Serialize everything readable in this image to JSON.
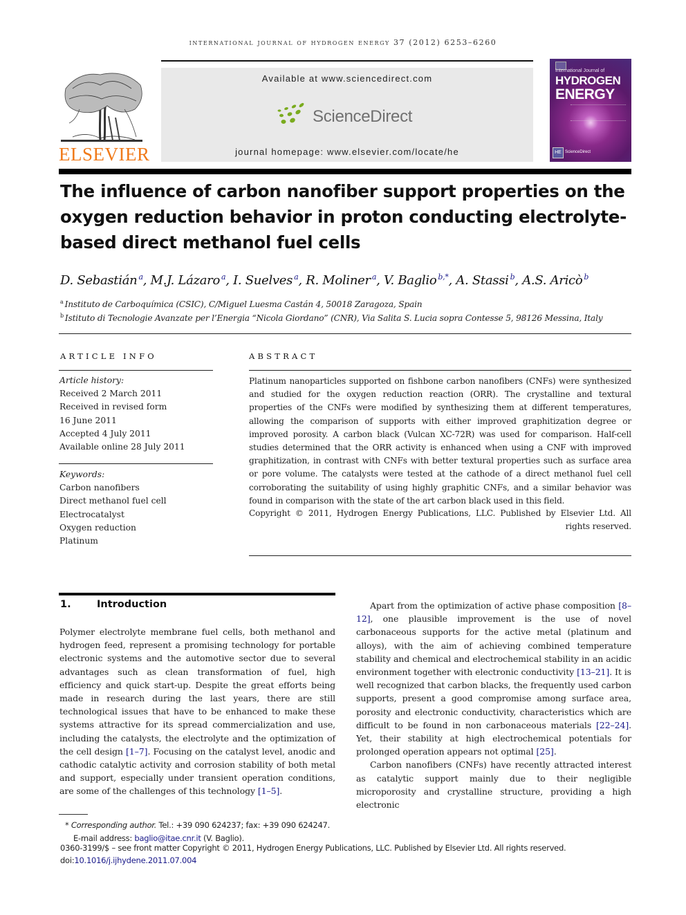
{
  "header": {
    "running_head": "International Journal of Hydrogen Energy 37 (2012) 6253–6260",
    "publisher_logo_text": "ELSEVIER",
    "available_at": "Available at www.sciencedirect.com",
    "sciencedirect_brand": "ScienceDirect",
    "journal_homepage": "journal homepage: www.elsevier.com/locate/he",
    "cover": {
      "small_title": "International Journal of",
      "title_line1": "HYDROGEN",
      "title_line2": "ENERGY",
      "badge": "HE",
      "footer": "ScienceDirect"
    },
    "colors": {
      "elsevier_orange": "#f07a1a",
      "sciencedirect_green": "#7aab1e",
      "sciencedirect_gray": "#707070",
      "link_blue": "#1a1a8a",
      "banner_gray": "#e9e9e9"
    }
  },
  "article": {
    "title": "The influence of carbon nanofiber support properties on the oxygen reduction behavior in proton conducting electrolyte-based direct methanol fuel cells",
    "authors": [
      {
        "name": "D. Sebastián",
        "sup": "a"
      },
      {
        "name": "M.J. Lázaro",
        "sup": "a"
      },
      {
        "name": "I. Suelves",
        "sup": "a"
      },
      {
        "name": "R. Moliner",
        "sup": "a"
      },
      {
        "name": "V. Baglio",
        "sup": "b,*"
      },
      {
        "name": "A. Stassi",
        "sup": "b"
      },
      {
        "name": "A.S. Aricò",
        "sup": "b"
      }
    ],
    "affiliations": [
      {
        "label": "a",
        "text": "Instituto de Carboquímica (CSIC), C/Miguel Luesma Castán 4, 50018 Zaragoza, Spain"
      },
      {
        "label": "b",
        "text": "Istituto di Tecnologie Avanzate per l’Energia “Nicola Giordano” (CNR), Via Salita S. Lucia sopra Contesse 5, 98126 Messina, Italy"
      }
    ]
  },
  "article_info": {
    "heading": "ARTICLE INFO",
    "history_label": "Article history:",
    "history": [
      "Received 2 March 2011",
      "Received in revised form",
      "16 June 2011",
      "Accepted 4 July 2011",
      "Available online 28 July 2011"
    ],
    "keywords_label": "Keywords:",
    "keywords": [
      "Carbon nanofibers",
      "Direct methanol fuel cell",
      "Electrocatalyst",
      "Oxygen reduction",
      "Platinum"
    ]
  },
  "abstract": {
    "heading": "ABSTRACT",
    "text": "Platinum nanoparticles supported on fishbone carbon nanofibers (CNFs) were synthesized and studied for the oxygen reduction reaction (ORR). The crystalline and textural properties of the CNFs were modified by synthesizing them at different temperatures, allowing the comparison of supports with either improved graphitization degree or improved porosity. A carbon black (Vulcan XC-72R) was used for comparison. Half-cell studies determined that the ORR activity is enhanced when using a CNF with improved graphitization, in contrast with CNFs with better textural properties such as surface area or pore volume. The catalysts were tested at the cathode of a direct methanol fuel cell corroborating the suitability of using highly graphitic CNFs, and a similar behavior was found in comparison with the state of the art carbon black used in this field.",
    "copyright": "Copyright © 2011, Hydrogen Energy Publications, LLC. Published by Elsevier Ltd. All rights reserved."
  },
  "introduction": {
    "number": "1.",
    "heading": "Introduction",
    "col1": {
      "p1_a": "Polymer electrolyte membrane fuel cells, both methanol and hydrogen feed, represent a promising technology for portable electronic systems and the automotive sector due to several advantages such as clean transformation of fuel, high efficiency and quick start-up. Despite the great efforts being made in research during the last years, there are still technological issues that have to be enhanced to make these systems attractive for its spread commercialization and use, including the catalysts, the electrolyte and the optimization of the cell design ",
      "ref1": "[1–7]",
      "p1_b": ". Focusing on the catalyst level, anodic and cathodic catalytic activity and corrosion stability of both metal and support, especially under transient operation conditions, are some of the challenges of this technology ",
      "ref2": "[1–5]",
      "p1_c": "."
    },
    "col2": {
      "p1_a": "Apart from the optimization of active phase composition ",
      "ref1": "[8–12]",
      "p1_b": ", one plausible improvement is the use of novel carbonaceous supports for the active metal (platinum and alloys), with the aim of achieving combined temperature stability and chemical and electrochemical stability in an acidic environment together with electronic conductivity ",
      "ref2": "[13–21]",
      "p1_c": ". It is well recognized that carbon blacks, the frequently used carbon supports, present a good compromise among surface area, porosity and electronic conductivity, characteristics which are difficult to be found in non carbonaceous materials ",
      "ref3": "[22–24]",
      "p1_d": ". Yet, their stability at high electrochemical potentials for prolonged operation appears not optimal ",
      "ref4": "[25]",
      "p1_e": ".",
      "p2": "Carbon nanofibers (CNFs) have recently attracted interest as catalytic support mainly due to their negligible microporosity and crystalline structure, providing a high electronic"
    }
  },
  "footnotes": {
    "corresponding_mark": "*",
    "corresponding_label": "Corresponding author.",
    "contact": " Tel.: +39 090 624237; fax: +39 090 624247.",
    "email_label": "E-mail address: ",
    "email": "baglio@itae.cnr.it",
    "email_owner": " (V. Baglio).",
    "front_matter": "0360-3199/$ – see front matter Copyright © 2011, Hydrogen Energy Publications, LLC. Published by Elsevier Ltd. All rights reserved.",
    "doi_label": "doi:",
    "doi": "10.1016/j.ijhydene.2011.07.004"
  }
}
